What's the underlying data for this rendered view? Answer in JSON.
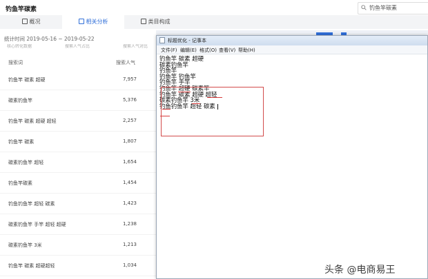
{
  "app_title": "钓鱼竿碳素",
  "search": {
    "value": "钓鱼竿碳素"
  },
  "tabs": [
    {
      "label": "概况"
    },
    {
      "label": "相关分析"
    },
    {
      "label": "类目构成"
    }
  ],
  "stat_time": "统计时间 2019-05-16 ~ 2019-05-22",
  "left_table": {
    "header_strip": [
      "核心转化数据",
      "搜索人气占比",
      "搜索人气对比"
    ],
    "columns": {
      "keyword": "搜索词",
      "popularity": "搜索人气"
    },
    "rows": [
      {
        "keyword": "钓鱼竿 碳素 超硬",
        "popularity": "7,957"
      },
      {
        "keyword": "碳素钓鱼竿",
        "popularity": "5,376"
      },
      {
        "keyword": "钓鱼竿 碳素 超硬 超轻",
        "popularity": "2,257"
      },
      {
        "keyword": "钓鱼竿 碳素",
        "popularity": "1,807"
      },
      {
        "keyword": "碳素钓鱼竿 超轻",
        "popularity": "1,654"
      },
      {
        "keyword": "钓鱼竿碳素",
        "popularity": "1,454"
      },
      {
        "keyword": "钓鱼钓鱼竿 超轻 碳素",
        "popularity": "1,423"
      },
      {
        "keyword": "碳素钓鱼竿 手竿 超轻 超硬",
        "popularity": "1,238"
      },
      {
        "keyword": "碳素钓鱼竿 3米",
        "popularity": "1,213"
      },
      {
        "keyword": "钓鱼竿 碳素 超硬超轻",
        "popularity": "1,034"
      }
    ]
  },
  "notepad": {
    "title": "标题优化 - 记事本",
    "menu": [
      "文件(F)",
      "编辑(E)",
      "格式(O)",
      "查看(V)",
      "帮助(H)"
    ],
    "lines": [
      "钓鱼竿 碳素 超硬",
      "碳素钓鱼竿",
      "钓鱼竿",
      "钓鱼竿 钓鱼竿",
      "钓鱼竿 手竿",
      "钓鱼竿 超硬 碳素竿",
      "钓鱼竿 碳素 超硬 超轻",
      "碳素钓鱼竿 3米",
      "钓鱼钓鱼竿 超轻 碳素"
    ]
  },
  "watermark": "头条 @电商易王",
  "colors": {
    "accent": "#2f6ed8",
    "highlight_red": "#d24a4a"
  }
}
